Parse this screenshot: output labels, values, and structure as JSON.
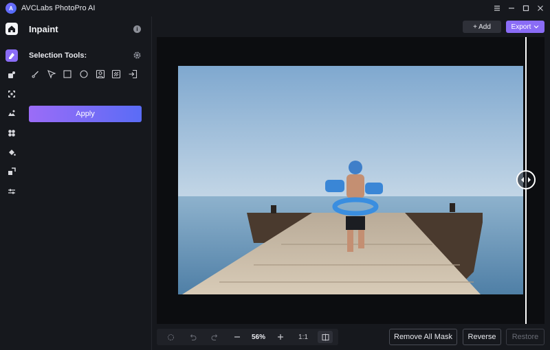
{
  "titlebar": {
    "app_title": "AVCLabs PhotoPro AI",
    "logo_glyph": "A"
  },
  "panel": {
    "title": "Inpaint",
    "selection_label": "Selection Tools:",
    "apply_label": "Apply"
  },
  "toolbar": {
    "add_label": "+ Add",
    "export_label": "Export"
  },
  "bottom": {
    "zoom": "56%",
    "ratio": "1:1",
    "remove_all_mask_label": "Remove All Mask",
    "reverse_label": "Reverse",
    "restore_label": "Restore"
  },
  "rail_icons": [
    "home-icon",
    "inpaint-icon",
    "object-remover-icon",
    "upscale-icon",
    "background-icon",
    "enhance-icon",
    "colorize-icon",
    "resize-icon",
    "adjust-icon"
  ],
  "selection_tools": [
    "brush-tool-icon",
    "lasso-tool-icon",
    "rectangle-tool-icon",
    "ellipse-tool-icon",
    "portrait-tool-icon",
    "pattern-tool-icon",
    "import-tool-icon"
  ],
  "colors": {
    "accent": "#8a6cf6",
    "background": "#16181d",
    "canvas": "#0c0d10"
  }
}
